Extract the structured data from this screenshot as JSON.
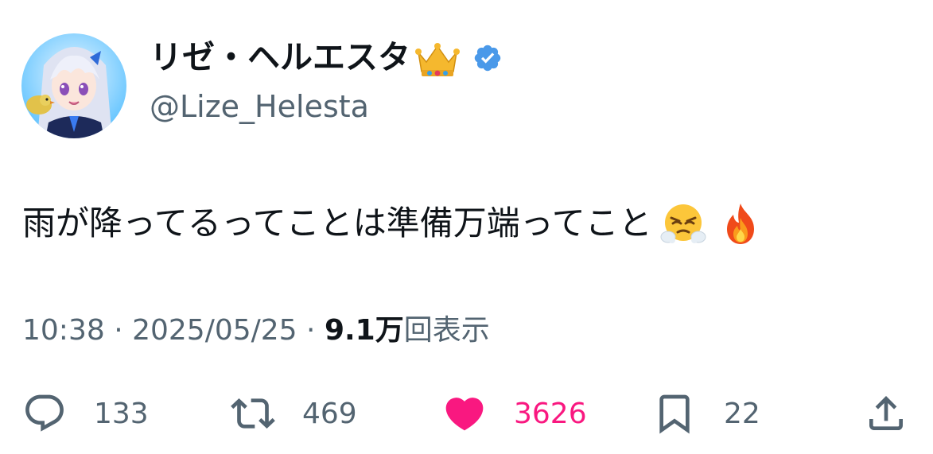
{
  "author": {
    "display_name": "リゼ・ヘルエスタ",
    "handle": "@Lize_Helesta",
    "name_emoji": "crown-icon",
    "verified_badge": "verified-icon",
    "verified_color": "#4a99e9"
  },
  "tweet": {
    "text": "雨が降ってるってことは準備万端ってこと",
    "trailing_emojis": [
      "face-with-steam-from-nose-icon",
      "fire-icon"
    ]
  },
  "meta": {
    "time": "10:38",
    "separator": " · ",
    "date": "2025/05/25",
    "views_count": "9.1万",
    "views_label": "回表示"
  },
  "actions": {
    "reply_count": "133",
    "retweet_count": "469",
    "like_count": "3626",
    "bookmark_count": "22"
  },
  "colors": {
    "text_primary": "#0f1419",
    "text_secondary": "#536471",
    "like": "#f91880"
  }
}
